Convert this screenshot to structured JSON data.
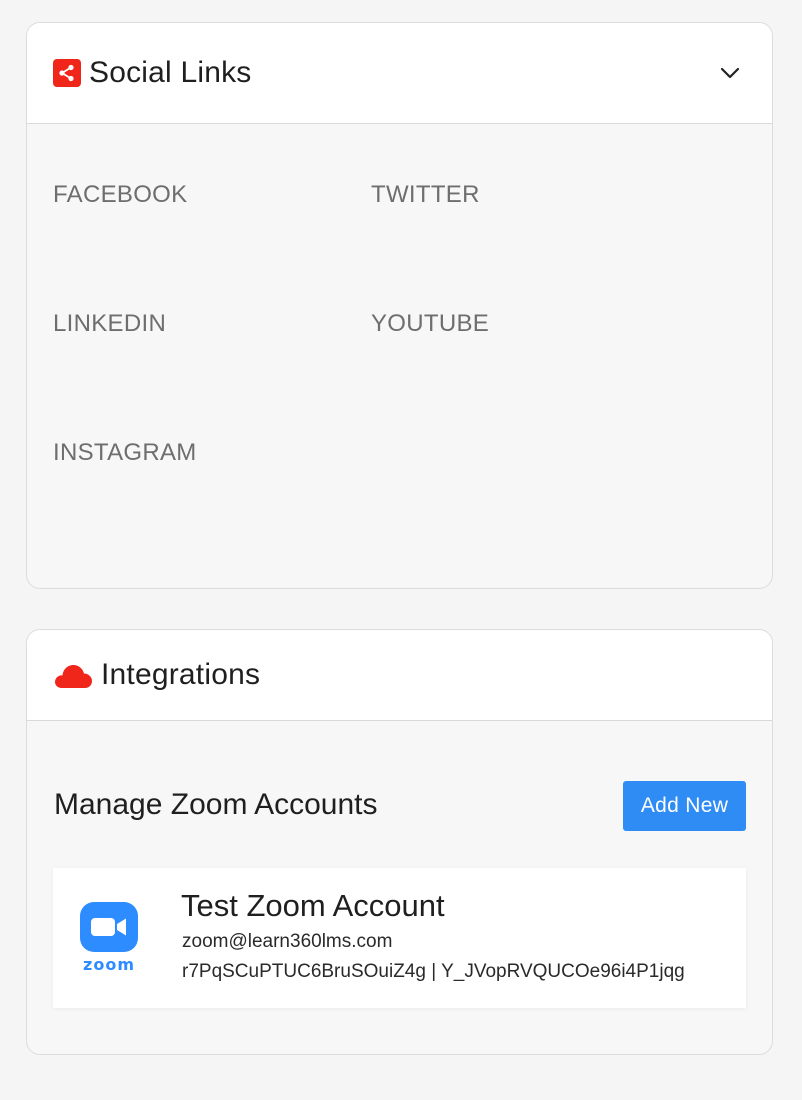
{
  "social": {
    "title": "Social Links",
    "icon": "share-icon",
    "toggle_icon": "chevron-down-icon",
    "links": [
      "FACEBOOK",
      "TWITTER",
      "LINKEDIN",
      "YOUTUBE",
      "INSTAGRAM"
    ]
  },
  "integrations": {
    "title": "Integrations",
    "icon": "cloud-icon",
    "zoom": {
      "heading": "Manage Zoom Accounts",
      "add_label": "Add New",
      "account": {
        "logo_text": "zoom",
        "name": "Test Zoom Account",
        "email": "zoom@learn360lms.com",
        "keys": "r7PqSCuPTUC6BruSOuiZ4g | Y_JVopRVQUCOe96i4P1jqg"
      }
    }
  },
  "colors": {
    "accent_red": "#f0261b",
    "button_blue": "#2f8cf5",
    "zoom_blue": "#2d8cff"
  }
}
